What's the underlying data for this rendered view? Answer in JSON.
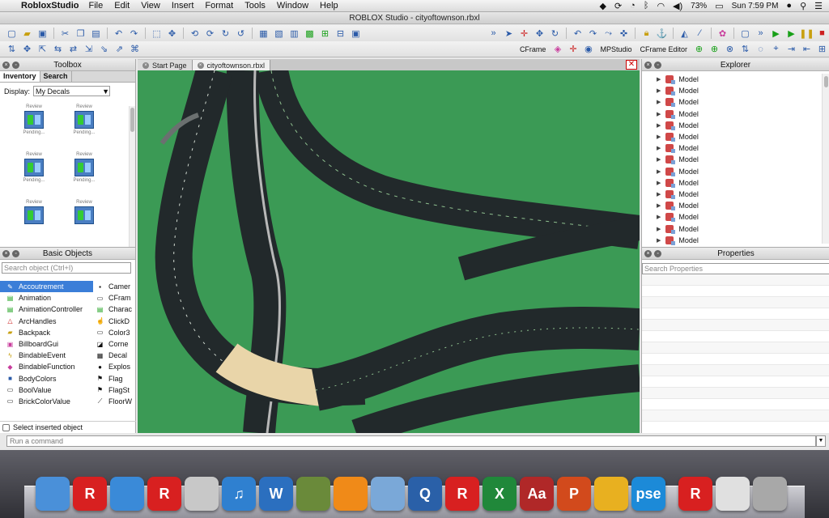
{
  "menubar": {
    "app_name": "RobloxStudio",
    "menus": [
      "File",
      "Edit",
      "View",
      "Insert",
      "Format",
      "Tools",
      "Window",
      "Help"
    ],
    "battery": "73%",
    "clock": "Sun 7:59 PM"
  },
  "window": {
    "title": "ROBLOX Studio - cityoftownson.rbxl"
  },
  "toolbar2": {
    "cframe_label": "CFrame",
    "mpstudio_label": "MPStudio",
    "cframe_editor_label": "CFrame Editor"
  },
  "toolbox": {
    "title": "Toolbox",
    "tabs": [
      "Inventory",
      "Search"
    ],
    "display_label": "Display:",
    "display_value": "My Decals",
    "decals": [
      {
        "top": "Review",
        "bottom": "Pending..."
      },
      {
        "top": "Review",
        "bottom": "Pending..."
      },
      {
        "top": "Review",
        "bottom": "Pending..."
      },
      {
        "top": "Review",
        "bottom": "Pending..."
      },
      {
        "top": "Review",
        "bottom": ""
      },
      {
        "top": "Review",
        "bottom": ""
      }
    ]
  },
  "basic_objects": {
    "title": "Basic Objects",
    "search_placeholder": "Search object (Ctrl+I)",
    "col1": [
      "Accoutrement",
      "Animation",
      "AnimationController",
      "ArcHandles",
      "Backpack",
      "BillboardGui",
      "BindableEvent",
      "BindableFunction",
      "BodyColors",
      "BoolValue",
      "BrickColorValue"
    ],
    "col2": [
      "Camer",
      "CFram",
      "Charac",
      "ClickD",
      "Color3",
      "Corne",
      "Decal",
      "Explos",
      "Flag",
      "FlagSt",
      "FloorW"
    ],
    "select_inserted_label": "Select inserted object"
  },
  "doc_tabs": [
    "Start Page",
    "cityoftownson.rbxl"
  ],
  "explorer": {
    "title": "Explorer",
    "items": [
      "Model",
      "Model",
      "Model",
      "Model",
      "Model",
      "Model",
      "Model",
      "Model",
      "Model",
      "Model",
      "Model",
      "Model",
      "Model",
      "Model",
      "Model"
    ]
  },
  "properties": {
    "title": "Properties",
    "search_placeholder": "Search Properties"
  },
  "command": {
    "placeholder": "Run a command"
  },
  "dock": [
    {
      "name": "finder",
      "label": "",
      "color": "#4a90d9"
    },
    {
      "name": "roblox",
      "label": "R",
      "color": "#d82020"
    },
    {
      "name": "safari",
      "label": "",
      "color": "#3a8ad8"
    },
    {
      "name": "roblox-player",
      "label": "R",
      "color": "#d82020"
    },
    {
      "name": "preview-doc",
      "label": "",
      "color": "#c8c8c8"
    },
    {
      "name": "itunes",
      "label": "♫",
      "color": "#2f80d0"
    },
    {
      "name": "word",
      "label": "W",
      "color": "#2b6fbf"
    },
    {
      "name": "minecraft",
      "label": "",
      "color": "#6a8a3a"
    },
    {
      "name": "ibooks",
      "label": "",
      "color": "#f08a18"
    },
    {
      "name": "preview",
      "label": "",
      "color": "#7aa8d8"
    },
    {
      "name": "quicktime",
      "label": "Q",
      "color": "#2a60a8"
    },
    {
      "name": "roblox-studio",
      "label": "R",
      "color": "#d82020"
    },
    {
      "name": "excel",
      "label": "X",
      "color": "#20883a"
    },
    {
      "name": "dictionary",
      "label": "Aa",
      "color": "#b02828"
    },
    {
      "name": "powerpoint",
      "label": "P",
      "color": "#d24a1c"
    },
    {
      "name": "chrome",
      "label": "",
      "color": "#e8b020"
    },
    {
      "name": "photoshop-elements",
      "label": "pse",
      "color": "#1c8ad8"
    },
    {
      "name": "roblox-2",
      "label": "R",
      "color": "#d82020"
    },
    {
      "name": "jpeg-file",
      "label": "",
      "color": "#e0e0e0"
    },
    {
      "name": "trash",
      "label": "",
      "color": "#a8a8a8"
    }
  ]
}
